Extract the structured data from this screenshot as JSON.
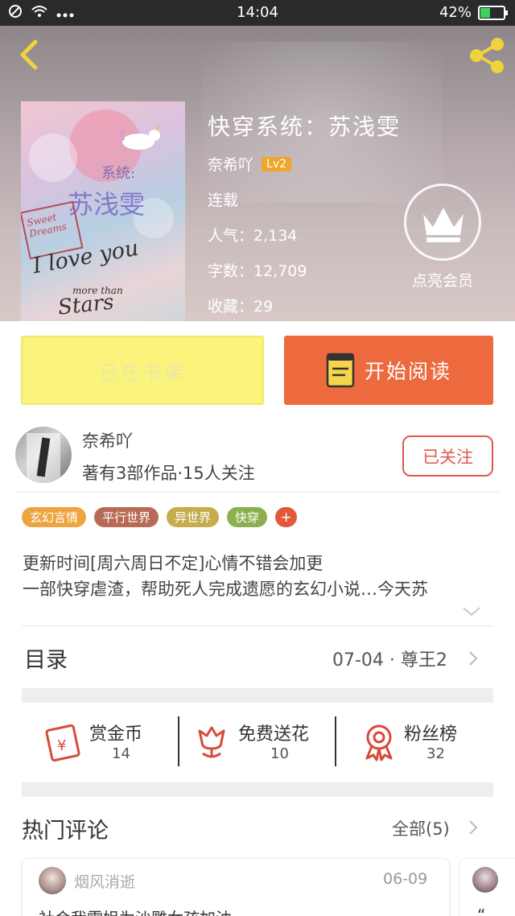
{
  "status_bar": {
    "time": "14:04",
    "battery": "42%",
    "battery_level": 0.42
  },
  "book": {
    "title": "快穿系统：苏浅雯",
    "author": "奈希吖",
    "level": "Lv2",
    "status": "连载",
    "popularity": "人气：2,134",
    "word_count": "字数：12,709",
    "favorites": "收藏：29"
  },
  "cover": {
    "line1": "系统:",
    "line2": "苏浅雯",
    "line3": "I love you",
    "line4": "more than",
    "line5": "Stars",
    "sign": "Sweet Dreams"
  },
  "vip": {
    "label": "点亮会员"
  },
  "actions": {
    "shelf_label": "已在书架",
    "read_label": "开始阅读"
  },
  "author_card": {
    "name": "奈希吖",
    "stats": "著有3部作品·15人关注",
    "follow_label": "已关注"
  },
  "tags": [
    {
      "label": "玄幻言情",
      "color": "#eda540"
    },
    {
      "label": "平行世界",
      "color": "#b86a55"
    },
    {
      "label": "异世界",
      "color": "#c5ad4e"
    },
    {
      "label": "快穿",
      "color": "#8cb04f"
    }
  ],
  "tag_add": "+",
  "description": {
    "line1": "更新时间[周六周日不定]心情不错会加更",
    "line2": "一部快穿虐渣，帮助死人完成遗愿的玄幻小说…今天苏"
  },
  "toc": {
    "label": "目录",
    "latest": "07-04 · 尊王2"
  },
  "stats": [
    {
      "label": "赏金币",
      "value": "14"
    },
    {
      "label": "免费送花",
      "value": "10"
    },
    {
      "label": "粉丝榜",
      "value": "32"
    }
  ],
  "comments": {
    "section_title": "热门评论",
    "all_label": "全部(5)",
    "items": [
      {
        "user": "烟风消逝",
        "date": "06-09",
        "text": "社会我雯姐为沙雕女孩加油"
      },
      {
        "text": "“"
      }
    ]
  }
}
